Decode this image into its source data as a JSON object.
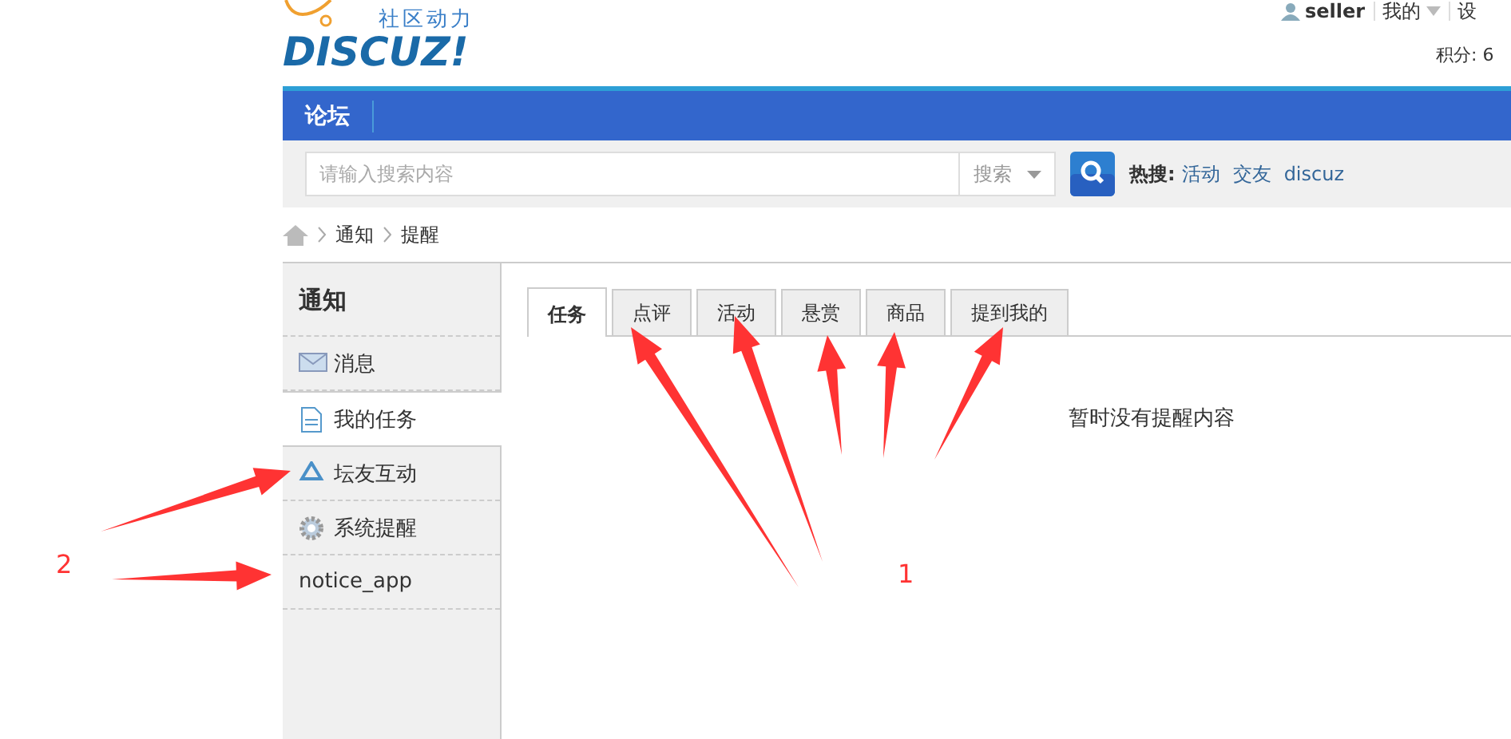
{
  "header": {
    "logo_tagline": "社区动力",
    "logo_text": "DISCUZ!",
    "user": "seller",
    "user_menu": "我的",
    "settings": "设",
    "points": "积分: 6"
  },
  "nav": {
    "items": [
      {
        "label": "论坛"
      }
    ]
  },
  "search": {
    "placeholder": "请输入搜索内容",
    "scope": "搜索",
    "hot_label": "热搜:",
    "hot_links": [
      "活动",
      "交友",
      "discuz"
    ]
  },
  "breadcrumb": [
    "通知",
    "提醒"
  ],
  "sidebar": {
    "title": "通知",
    "items": [
      {
        "label": "消息",
        "selected": false
      },
      {
        "label": "我的任务",
        "selected": true
      },
      {
        "label": "坛友互动",
        "selected": false
      },
      {
        "label": "系统提醒",
        "selected": false
      },
      {
        "label": "notice_app",
        "selected": false
      }
    ]
  },
  "tabs": [
    {
      "label": "任务",
      "selected": true
    },
    {
      "label": "点评",
      "selected": false
    },
    {
      "label": "活动",
      "selected": false
    },
    {
      "label": "悬赏",
      "selected": false
    },
    {
      "label": "商品",
      "selected": false
    },
    {
      "label": "提到我的",
      "selected": false
    }
  ],
  "empty_message": "暂时没有提醒内容",
  "annotations": [
    {
      "label": "1"
    },
    {
      "label": "2"
    }
  ]
}
